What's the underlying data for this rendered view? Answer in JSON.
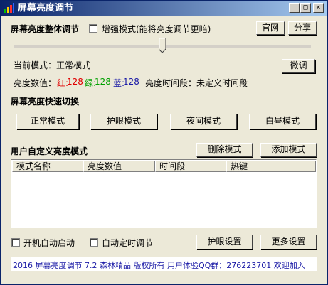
{
  "window": {
    "title": "屏幕亮度调节",
    "controls": {
      "minimize": "_",
      "maximize": "□",
      "close": "×"
    }
  },
  "overall": {
    "heading": "屏幕亮度整体调节",
    "enhance_checkbox_label": "增强模式(能将亮度调节更暗)",
    "enhance_checked": false,
    "official_site_button": "官网",
    "share_button": "分享",
    "brightness_level": 0.5
  },
  "status": {
    "current_mode_label": "当前模式：",
    "current_mode_value": "正常模式",
    "fine_tune_button": "微调",
    "brightness_value_label": "亮度数值：",
    "red_label": "红:",
    "red_value": "128",
    "green_label": "绿:",
    "green_value": "128",
    "blue_label": "蓝:",
    "blue_value": "128",
    "period_label": "亮度时间段：",
    "period_value": "未定义时间段"
  },
  "quick_switch": {
    "heading": "屏幕亮度快速切换",
    "buttons": [
      "正常模式",
      "护眼模式",
      "夜间模式",
      "白昼模式"
    ]
  },
  "custom": {
    "heading": "用户自定义亮度模式",
    "delete_button": "删除模式",
    "add_button": "添加模式",
    "columns": [
      "模式名称",
      "亮度数值",
      "时间段",
      "热键"
    ],
    "rows": []
  },
  "bottom": {
    "autostart_label": "开机自动启动",
    "autostart_checked": false,
    "auto_timer_label": "自动定时调节",
    "auto_timer_checked": false,
    "eye_settings_button": "护眼设置",
    "more_settings_button": "更多设置"
  },
  "statusbar": {
    "text": "2016  屏幕亮度调节 7.2 森林精品 版权所有 用户体验QQ群：276223701 欢迎加入"
  },
  "colors": {
    "titlebar_start": "#0a246a",
    "titlebar_end": "#a6caf0",
    "red": "#e00000",
    "green": "#00a000",
    "blue": "#1a1aa6",
    "face": "#ece9d8"
  },
  "icons": {
    "app": "bar-chart-icon",
    "slider_thumb": "slider-thumb"
  }
}
